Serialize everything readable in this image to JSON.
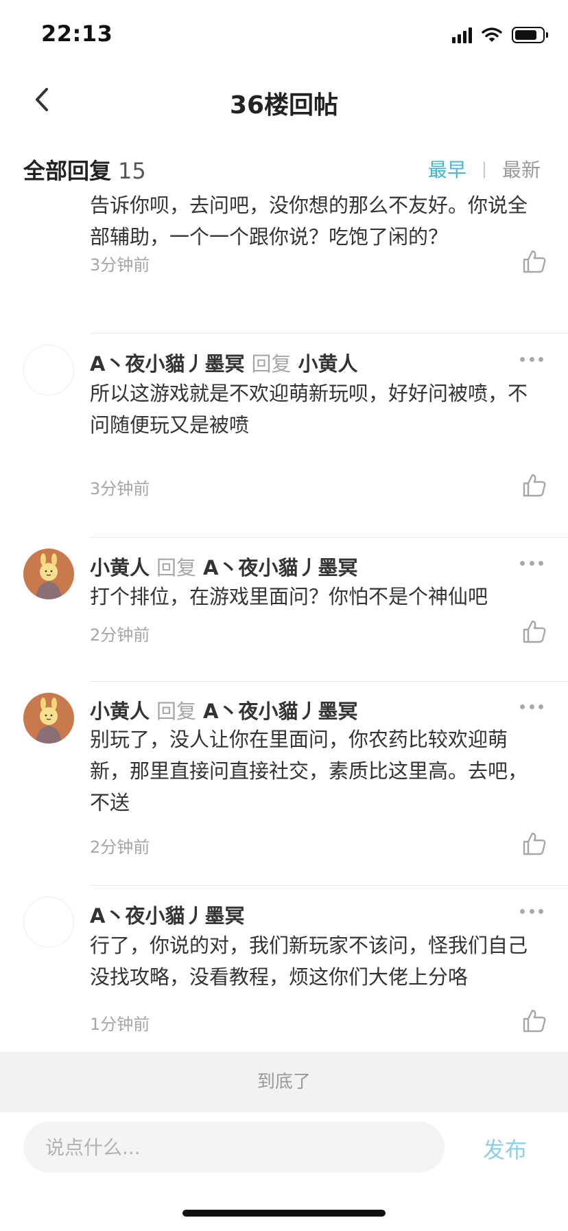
{
  "status_bar": {
    "time": "22:13",
    "battery_level_percent": 85
  },
  "nav": {
    "title": "36楼回帖"
  },
  "replies_header": {
    "title": "全部回复",
    "count": "15",
    "sort_earliest": "最早",
    "sort_divider": "|",
    "sort_latest": "最新"
  },
  "colors": {
    "accent": "#4ab3cf",
    "publish_disabled": "#8fd0e2",
    "avatar_bg": "#c97a4c"
  },
  "replies": [
    {
      "text": "告诉你呗，去问吧，没你想的那么不友好。你说全部辅助，一个一个跟你说？吃饱了闲的？",
      "time": "3分钟前"
    },
    {
      "author": "A丶夜小貓丿墨冥",
      "reply_word": "回复",
      "reply_to": "小黄人",
      "text": "所以这游戏就是不欢迎萌新玩呗，好好问被喷，不问随便玩又是被喷",
      "time": "3分钟前",
      "avatar": "empty"
    },
    {
      "author": "小黄人",
      "reply_word": "回复",
      "reply_to": "A丶夜小貓丿墨冥",
      "text": "打个排位，在游戏里面问？你怕不是个神仙吧",
      "time": "2分钟前",
      "avatar": "bunny"
    },
    {
      "author": "小黄人",
      "reply_word": "回复",
      "reply_to": "A丶夜小貓丿墨冥",
      "text": "别玩了，没人让你在里面问，你农药比较欢迎萌新，那里直接问直接社交，素质比这里高。去吧，不送",
      "time": "2分钟前",
      "avatar": "bunny"
    },
    {
      "author": "A丶夜小貓丿墨冥",
      "text": "行了，你说的对，我们新玩家不该问，怪我们自己没找攻略，没看教程，烦这你们大佬上分咯",
      "time": "1分钟前",
      "avatar": "empty"
    }
  ],
  "end_banner": "到底了",
  "composer": {
    "placeholder": "说点什么...",
    "value": "",
    "publish_label": "发布"
  }
}
